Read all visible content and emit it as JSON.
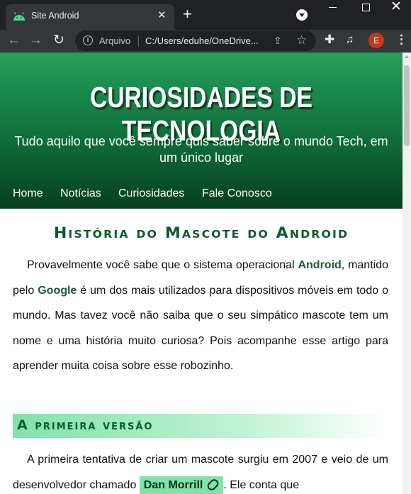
{
  "browser": {
    "tab_title": "Site Android",
    "tab_close": "✕",
    "new_tab": "+",
    "window_close": "✕",
    "address_source": "Arquivo",
    "address_url": "C:/Users/eduhe/OneDrive...",
    "profile_initial": "E",
    "icons": [
      "android-icon",
      "search-tabs-icon",
      "back-icon",
      "forward-icon",
      "reload-icon",
      "info-icon",
      "share-icon",
      "star-icon",
      "extensions-icon",
      "media-icon",
      "menu-icon"
    ],
    "nav_back": "←",
    "nav_forward": "→",
    "nav_reload": "↻",
    "share": "⇪",
    "star": "☆",
    "extensions": "✚",
    "media": "♫",
    "menu": "⋮"
  },
  "site": {
    "title": "CURIOSIDADES DE TECNOLOGIA",
    "subtitle": "Tudo aquilo que você sempre quis saber sobre o mundo Tech, em um único lugar",
    "nav": [
      "Home",
      "Notícias",
      "Curiosidades",
      "Fale Conosco"
    ]
  },
  "article": {
    "title": "História do Mascote do Android",
    "para1": {
      "t1": "Provavelmente você sabe que o sistema operacional ",
      "b1": "Android",
      "t2": ", mantido pelo ",
      "b2": "Google",
      "t3": " é um dos mais utilizados para dispositivos móveis em todo o mundo. Mas tavez você não saiba que o seu simpático mascote tem um nome e uma história muito curiosa? Pois acompanhe esse artigo para aprender muita coisa sobre esse robozinho."
    },
    "section1_title": "A primeira versão",
    "para2": {
      "t1": "A primeira tentativa de criar um mascote surgiu em 2007 e veio de um desenvolvedor chamado ",
      "link": "Dan Morrill",
      "t2": ". Ele conta que"
    }
  },
  "colors": {
    "header_top": "#279f5c",
    "header_bottom": "#063f1f",
    "accent_text": "#0c5a2c",
    "highlight": "#7fe3aa",
    "chrome_dark": "#202124",
    "chrome_bar": "#35363a",
    "profile": "#c2391b"
  }
}
